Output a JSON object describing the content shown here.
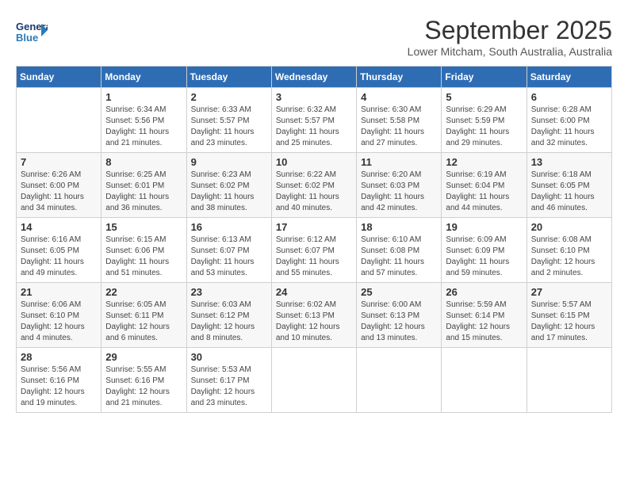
{
  "header": {
    "logo_general": "General",
    "logo_blue": "Blue",
    "month_title": "September 2025",
    "subtitle": "Lower Mitcham, South Australia, Australia"
  },
  "days_of_week": [
    "Sunday",
    "Monday",
    "Tuesday",
    "Wednesday",
    "Thursday",
    "Friday",
    "Saturday"
  ],
  "weeks": [
    [
      {
        "day": "",
        "info": ""
      },
      {
        "day": "1",
        "info": "Sunrise: 6:34 AM\nSunset: 5:56 PM\nDaylight: 11 hours\nand 21 minutes."
      },
      {
        "day": "2",
        "info": "Sunrise: 6:33 AM\nSunset: 5:57 PM\nDaylight: 11 hours\nand 23 minutes."
      },
      {
        "day": "3",
        "info": "Sunrise: 6:32 AM\nSunset: 5:57 PM\nDaylight: 11 hours\nand 25 minutes."
      },
      {
        "day": "4",
        "info": "Sunrise: 6:30 AM\nSunset: 5:58 PM\nDaylight: 11 hours\nand 27 minutes."
      },
      {
        "day": "5",
        "info": "Sunrise: 6:29 AM\nSunset: 5:59 PM\nDaylight: 11 hours\nand 29 minutes."
      },
      {
        "day": "6",
        "info": "Sunrise: 6:28 AM\nSunset: 6:00 PM\nDaylight: 11 hours\nand 32 minutes."
      }
    ],
    [
      {
        "day": "7",
        "info": "Sunrise: 6:26 AM\nSunset: 6:00 PM\nDaylight: 11 hours\nand 34 minutes."
      },
      {
        "day": "8",
        "info": "Sunrise: 6:25 AM\nSunset: 6:01 PM\nDaylight: 11 hours\nand 36 minutes."
      },
      {
        "day": "9",
        "info": "Sunrise: 6:23 AM\nSunset: 6:02 PM\nDaylight: 11 hours\nand 38 minutes."
      },
      {
        "day": "10",
        "info": "Sunrise: 6:22 AM\nSunset: 6:02 PM\nDaylight: 11 hours\nand 40 minutes."
      },
      {
        "day": "11",
        "info": "Sunrise: 6:20 AM\nSunset: 6:03 PM\nDaylight: 11 hours\nand 42 minutes."
      },
      {
        "day": "12",
        "info": "Sunrise: 6:19 AM\nSunset: 6:04 PM\nDaylight: 11 hours\nand 44 minutes."
      },
      {
        "day": "13",
        "info": "Sunrise: 6:18 AM\nSunset: 6:05 PM\nDaylight: 11 hours\nand 46 minutes."
      }
    ],
    [
      {
        "day": "14",
        "info": "Sunrise: 6:16 AM\nSunset: 6:05 PM\nDaylight: 11 hours\nand 49 minutes."
      },
      {
        "day": "15",
        "info": "Sunrise: 6:15 AM\nSunset: 6:06 PM\nDaylight: 11 hours\nand 51 minutes."
      },
      {
        "day": "16",
        "info": "Sunrise: 6:13 AM\nSunset: 6:07 PM\nDaylight: 11 hours\nand 53 minutes."
      },
      {
        "day": "17",
        "info": "Sunrise: 6:12 AM\nSunset: 6:07 PM\nDaylight: 11 hours\nand 55 minutes."
      },
      {
        "day": "18",
        "info": "Sunrise: 6:10 AM\nSunset: 6:08 PM\nDaylight: 11 hours\nand 57 minutes."
      },
      {
        "day": "19",
        "info": "Sunrise: 6:09 AM\nSunset: 6:09 PM\nDaylight: 11 hours\nand 59 minutes."
      },
      {
        "day": "20",
        "info": "Sunrise: 6:08 AM\nSunset: 6:10 PM\nDaylight: 12 hours\nand 2 minutes."
      }
    ],
    [
      {
        "day": "21",
        "info": "Sunrise: 6:06 AM\nSunset: 6:10 PM\nDaylight: 12 hours\nand 4 minutes."
      },
      {
        "day": "22",
        "info": "Sunrise: 6:05 AM\nSunset: 6:11 PM\nDaylight: 12 hours\nand 6 minutes."
      },
      {
        "day": "23",
        "info": "Sunrise: 6:03 AM\nSunset: 6:12 PM\nDaylight: 12 hours\nand 8 minutes."
      },
      {
        "day": "24",
        "info": "Sunrise: 6:02 AM\nSunset: 6:13 PM\nDaylight: 12 hours\nand 10 minutes."
      },
      {
        "day": "25",
        "info": "Sunrise: 6:00 AM\nSunset: 6:13 PM\nDaylight: 12 hours\nand 13 minutes."
      },
      {
        "day": "26",
        "info": "Sunrise: 5:59 AM\nSunset: 6:14 PM\nDaylight: 12 hours\nand 15 minutes."
      },
      {
        "day": "27",
        "info": "Sunrise: 5:57 AM\nSunset: 6:15 PM\nDaylight: 12 hours\nand 17 minutes."
      }
    ],
    [
      {
        "day": "28",
        "info": "Sunrise: 5:56 AM\nSunset: 6:16 PM\nDaylight: 12 hours\nand 19 minutes."
      },
      {
        "day": "29",
        "info": "Sunrise: 5:55 AM\nSunset: 6:16 PM\nDaylight: 12 hours\nand 21 minutes."
      },
      {
        "day": "30",
        "info": "Sunrise: 5:53 AM\nSunset: 6:17 PM\nDaylight: 12 hours\nand 23 minutes."
      },
      {
        "day": "",
        "info": ""
      },
      {
        "day": "",
        "info": ""
      },
      {
        "day": "",
        "info": ""
      },
      {
        "day": "",
        "info": ""
      }
    ]
  ]
}
